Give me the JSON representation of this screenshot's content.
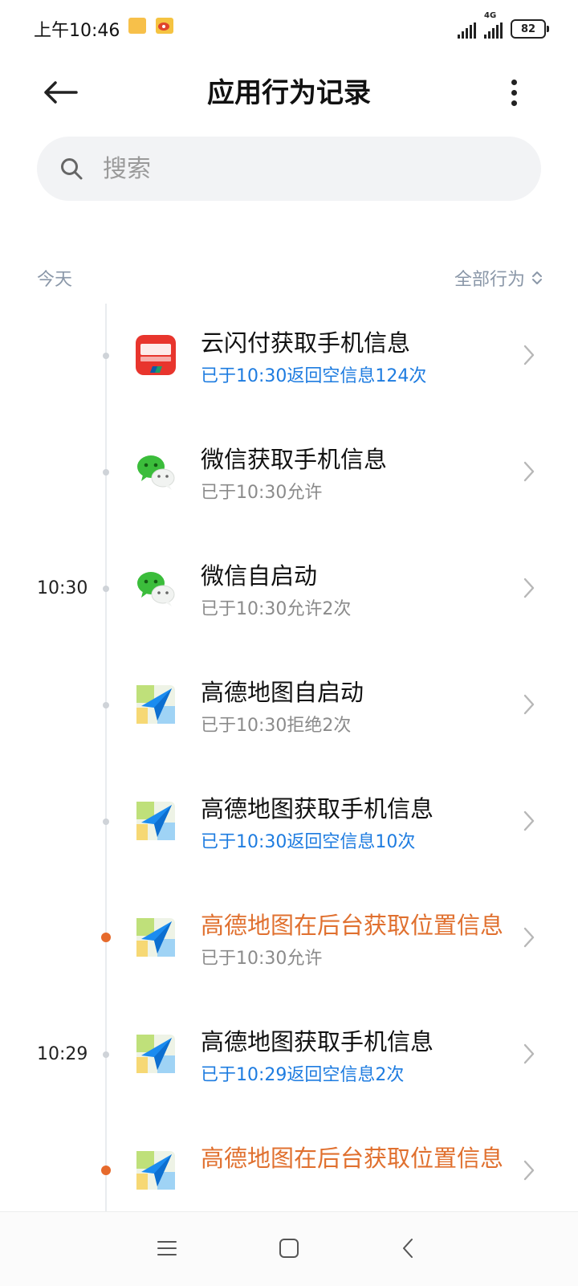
{
  "status_bar": {
    "time": "上午10:46",
    "network": "4G",
    "battery": "82"
  },
  "header": {
    "title": "应用行为记录"
  },
  "search": {
    "placeholder": "搜索"
  },
  "section": {
    "date_label": "今天",
    "filter_label": "全部行为"
  },
  "colors": {
    "accent_blue": "#1e7ce0",
    "warning_orange": "#e0702f",
    "muted_text": "#8b8b8b"
  },
  "records": [
    {
      "time": "",
      "app": "unionpay",
      "title": "云闪付获取手机信息",
      "subtitle": "已于10:30返回空信息124次",
      "subtitle_style": "blue",
      "warning": false
    },
    {
      "time": "",
      "app": "wechat",
      "title": "微信获取手机信息",
      "subtitle": "已于10:30允许",
      "subtitle_style": "gray",
      "warning": false
    },
    {
      "time": "10:30",
      "app": "wechat",
      "title": "微信自启动",
      "subtitle": "已于10:30允许2次",
      "subtitle_style": "gray",
      "warning": false
    },
    {
      "time": "",
      "app": "amap",
      "title": "高德地图自启动",
      "subtitle": "已于10:30拒绝2次",
      "subtitle_style": "gray",
      "warning": false
    },
    {
      "time": "",
      "app": "amap",
      "title": "高德地图获取手机信息",
      "subtitle": "已于10:30返回空信息10次",
      "subtitle_style": "blue",
      "warning": false
    },
    {
      "time": "",
      "app": "amap",
      "title": "高德地图在后台获取位置信息",
      "subtitle": "已于10:30允许",
      "subtitle_style": "gray",
      "warning": true
    },
    {
      "time": "10:29",
      "app": "amap",
      "title": "高德地图获取手机信息",
      "subtitle": "已于10:29返回空信息2次",
      "subtitle_style": "blue",
      "warning": false
    },
    {
      "time": "",
      "app": "amap",
      "title": "高德地图在后台获取位置信息",
      "subtitle": "",
      "subtitle_style": "gray",
      "warning": true
    }
  ]
}
